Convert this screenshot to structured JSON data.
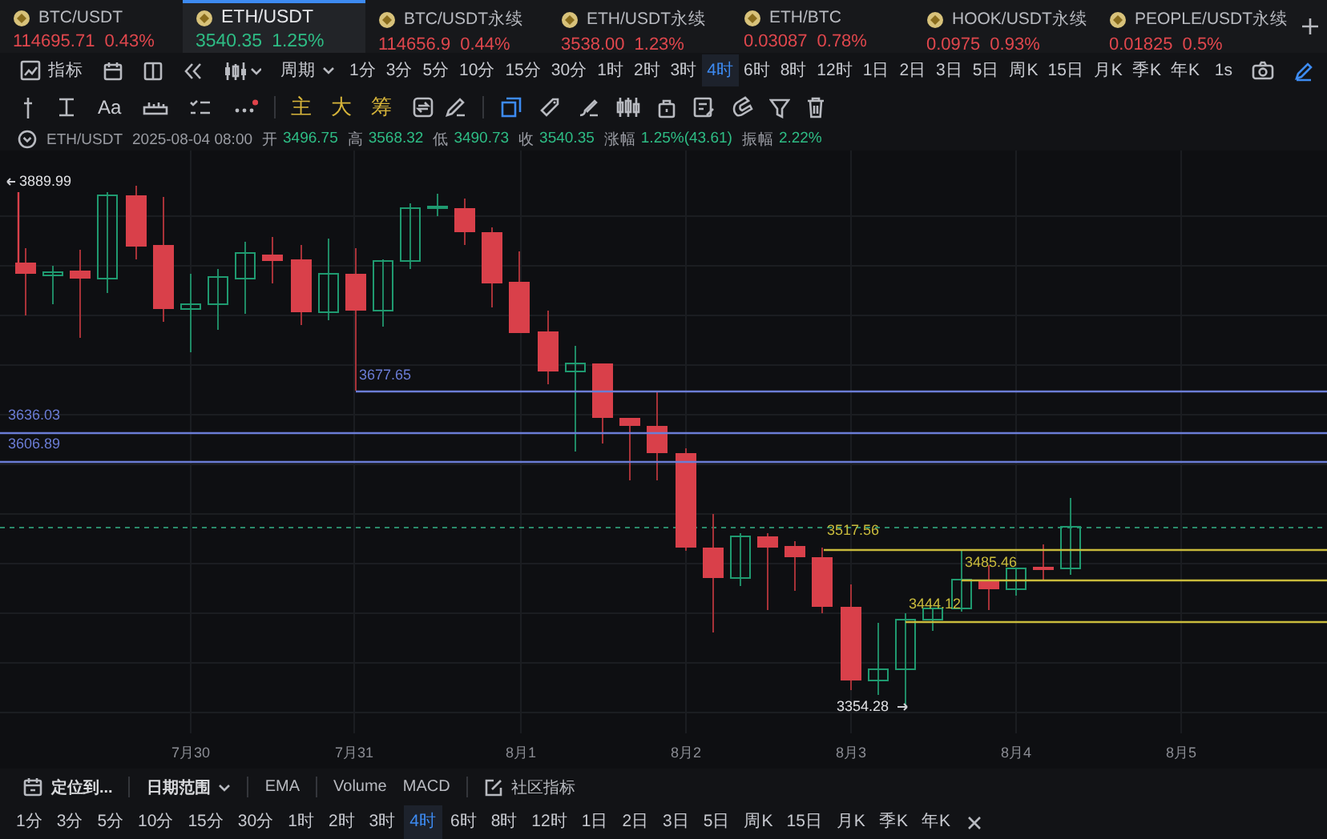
{
  "tickers": [
    {
      "symbol": "BTC/USDT",
      "price": "114695.71",
      "change": "0.43%",
      "color": "#e0474d",
      "selected": false
    },
    {
      "symbol": "ETH/USDT",
      "price": "3540.35",
      "change": "1.25%",
      "color": "#2ebd85",
      "selected": true
    },
    {
      "symbol": "BTC/USDT永续",
      "price": "114656.9",
      "change": "0.44%",
      "color": "#e0474d",
      "selected": false
    },
    {
      "symbol": "ETH/USDT永续",
      "price": "3538.00",
      "change": "1.23%",
      "color": "#e0474d",
      "selected": false
    },
    {
      "symbol": "ETH/BTC",
      "price": "0.03087",
      "change": "0.78%",
      "color": "#e0474d",
      "selected": false
    },
    {
      "symbol": "HOOK/USDT永续",
      "price": "0.0975",
      "change": "0.93%",
      "color": "#e0474d",
      "selected": false
    },
    {
      "symbol": "PEOPLE/USDT永续",
      "price": "0.01825",
      "change": "0.5%",
      "color": "#e0474d",
      "selected": false
    }
  ],
  "toolbar": {
    "indicator_label": "指标",
    "period_label": "周期",
    "interval": "1s",
    "periods": [
      {
        "label": "1分",
        "selected": false
      },
      {
        "label": "3分",
        "selected": false
      },
      {
        "label": "5分",
        "selected": false
      },
      {
        "label": "10分",
        "selected": false
      },
      {
        "label": "15分",
        "selected": false
      },
      {
        "label": "30分",
        "selected": false
      },
      {
        "label": "1时",
        "selected": false
      },
      {
        "label": "2时",
        "selected": false
      },
      {
        "label": "3时",
        "selected": false
      },
      {
        "label": "4时",
        "selected": true
      },
      {
        "label": "6时",
        "selected": false
      },
      {
        "label": "8时",
        "selected": false
      },
      {
        "label": "12时",
        "selected": false
      },
      {
        "label": "1日",
        "selected": false
      },
      {
        "label": "2日",
        "selected": false
      },
      {
        "label": "3日",
        "selected": false
      },
      {
        "label": "5日",
        "selected": false
      },
      {
        "label": "周K",
        "selected": false
      },
      {
        "label": "15日",
        "selected": false
      },
      {
        "label": "月K",
        "selected": false
      },
      {
        "label": "季K",
        "selected": false
      },
      {
        "label": "年K",
        "selected": false
      }
    ]
  },
  "drawing_tools": {
    "font_label": "Aa",
    "chips": [
      "主",
      "大",
      "筹"
    ]
  },
  "info_line": {
    "symbol": "ETH/USDT",
    "datetime": "2025-08-04 08:00",
    "fields": [
      {
        "label": "开",
        "value": "3496.75"
      },
      {
        "label": "高",
        "value": "3568.32"
      },
      {
        "label": "低",
        "value": "3490.73"
      },
      {
        "label": "收",
        "value": "3540.35"
      },
      {
        "label": "涨幅",
        "value": "1.25%(43.61)"
      },
      {
        "label": "振幅",
        "value": "2.22%"
      }
    ]
  },
  "chart": {
    "high_label": "3889.99",
    "low_label": "3354.28",
    "price_lines": [
      {
        "label": "3677.65",
        "color": "#6b7dd6"
      },
      {
        "label": "3636.03",
        "color": "#6b7dd6"
      },
      {
        "label": "3606.89",
        "color": "#6b7dd6"
      },
      {
        "label": "3517.56",
        "color": "#c9bb3c"
      },
      {
        "label": "3485.46",
        "color": "#c9bb3c"
      },
      {
        "label": "3444.12",
        "color": "#c9bb3c"
      }
    ],
    "dates": [
      "7月30",
      "7月31",
      "8月1",
      "8月2",
      "8月3",
      "8月4",
      "8月5"
    ]
  },
  "bottom_bar": {
    "locate_label": "定位到...",
    "date_range_label": "日期范围",
    "indicator_groups": [
      [
        "EMA"
      ],
      [
        "Volume",
        "MACD"
      ]
    ],
    "community_label": "社区指标"
  },
  "timeframes": [
    {
      "label": "1分",
      "selected": false
    },
    {
      "label": "3分",
      "selected": false
    },
    {
      "label": "5分",
      "selected": false
    },
    {
      "label": "10分",
      "selected": false
    },
    {
      "label": "15分",
      "selected": false
    },
    {
      "label": "30分",
      "selected": false
    },
    {
      "label": "1时",
      "selected": false
    },
    {
      "label": "2时",
      "selected": false
    },
    {
      "label": "3时",
      "selected": false
    },
    {
      "label": "4时",
      "selected": true
    },
    {
      "label": "6时",
      "selected": false
    },
    {
      "label": "8时",
      "selected": false
    },
    {
      "label": "12时",
      "selected": false
    },
    {
      "label": "1日",
      "selected": false
    },
    {
      "label": "2日",
      "selected": false
    },
    {
      "label": "3日",
      "selected": false
    },
    {
      "label": "5日",
      "selected": false
    },
    {
      "label": "周K",
      "selected": false
    },
    {
      "label": "15日",
      "selected": false
    },
    {
      "label": "月K",
      "selected": false
    },
    {
      "label": "季K",
      "selected": false
    },
    {
      "label": "年K",
      "selected": false
    }
  ]
}
